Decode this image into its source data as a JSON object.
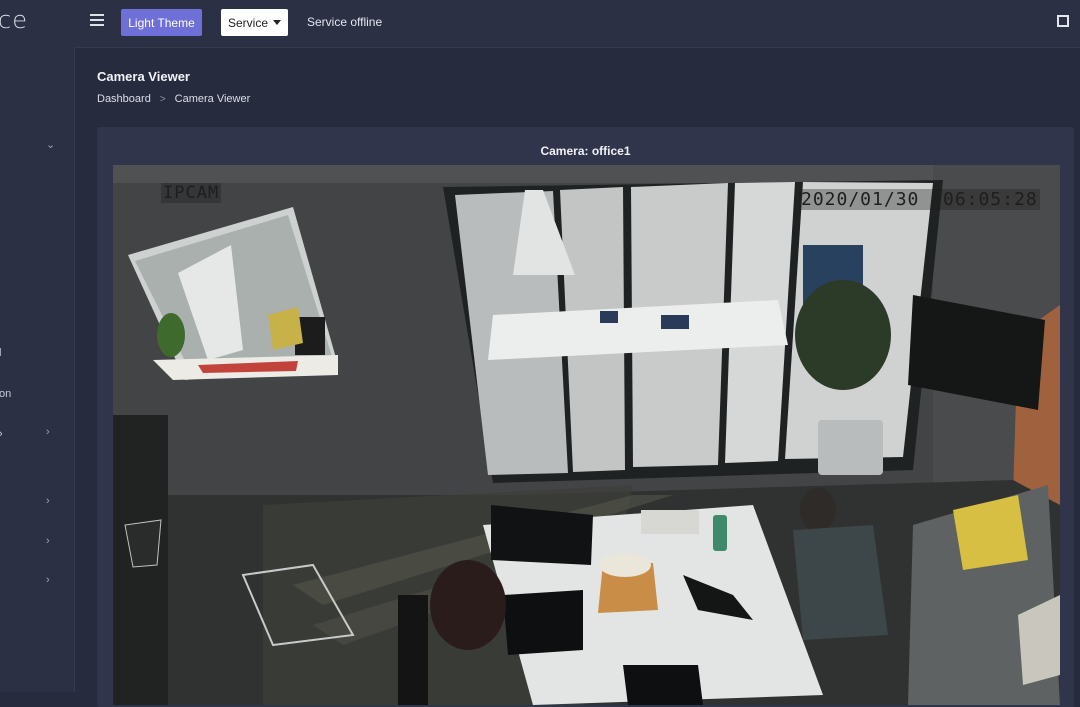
{
  "sidebar": {
    "brand": "ce",
    "items": [
      {
        "label": "l"
      },
      {
        "label": "on"
      }
    ]
  },
  "topbar": {
    "theme_button": "Light Theme",
    "service_button": "Service",
    "status": "Service offline"
  },
  "page": {
    "title": "Camera Viewer",
    "breadcrumb": [
      "Dashboard",
      "Camera Viewer"
    ]
  },
  "camera": {
    "title": "Camera: office1",
    "overlay_label": "IPCAM",
    "overlay_timestamp": "2020/01/30  06:05:28"
  },
  "colors": {
    "accent": "#6f6fd8",
    "background": "#272b3e",
    "panel": "#30354b"
  }
}
